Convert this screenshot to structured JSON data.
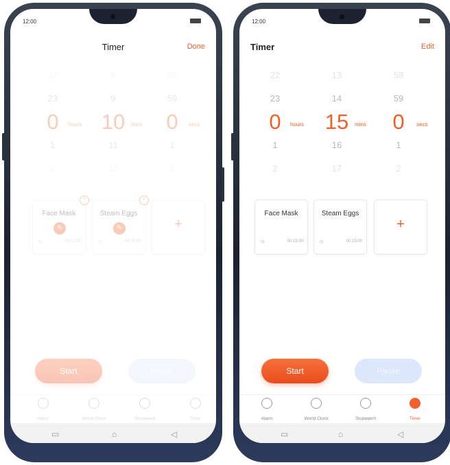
{
  "status_time": "12:00",
  "left": {
    "title": "Timer",
    "action": "Done",
    "picker": {
      "hours": [
        "22",
        "23",
        "0",
        "1",
        "2"
      ],
      "mins": [
        "8",
        "9",
        "10",
        "11",
        "12"
      ],
      "secs": [
        "58",
        "59",
        "0",
        "1",
        "2"
      ],
      "unit_hours": "hours",
      "unit_mins": "mins",
      "unit_secs": "secs"
    },
    "cards": [
      {
        "name": "Face Mask",
        "time": "00:15:00"
      },
      {
        "name": "Steam Eggs",
        "time": "00:15:00"
      }
    ],
    "start_label": "Start",
    "pause_label": "Pause"
  },
  "right": {
    "title": "Timer",
    "action": "Edit",
    "picker": {
      "hours": [
        "22",
        "23",
        "0",
        "1",
        "2"
      ],
      "mins": [
        "13",
        "14",
        "15",
        "16",
        "17"
      ],
      "secs": [
        "58",
        "59",
        "0",
        "1",
        "2"
      ],
      "unit_hours": "hours",
      "unit_mins": "mins",
      "unit_secs": "secs"
    },
    "cards": [
      {
        "name": "Face Mask",
        "time": "00:15:00"
      },
      {
        "name": "Steam Eggs",
        "time": "00:15:00"
      }
    ],
    "add_label": "+",
    "start_label": "Start",
    "pause_label": "Pause"
  },
  "tabs": [
    "Alarm",
    "World Clock",
    "Stopwatch",
    "Timer"
  ],
  "colors": {
    "accent": "#f0602a",
    "pause_bg": "#dde7fb"
  }
}
